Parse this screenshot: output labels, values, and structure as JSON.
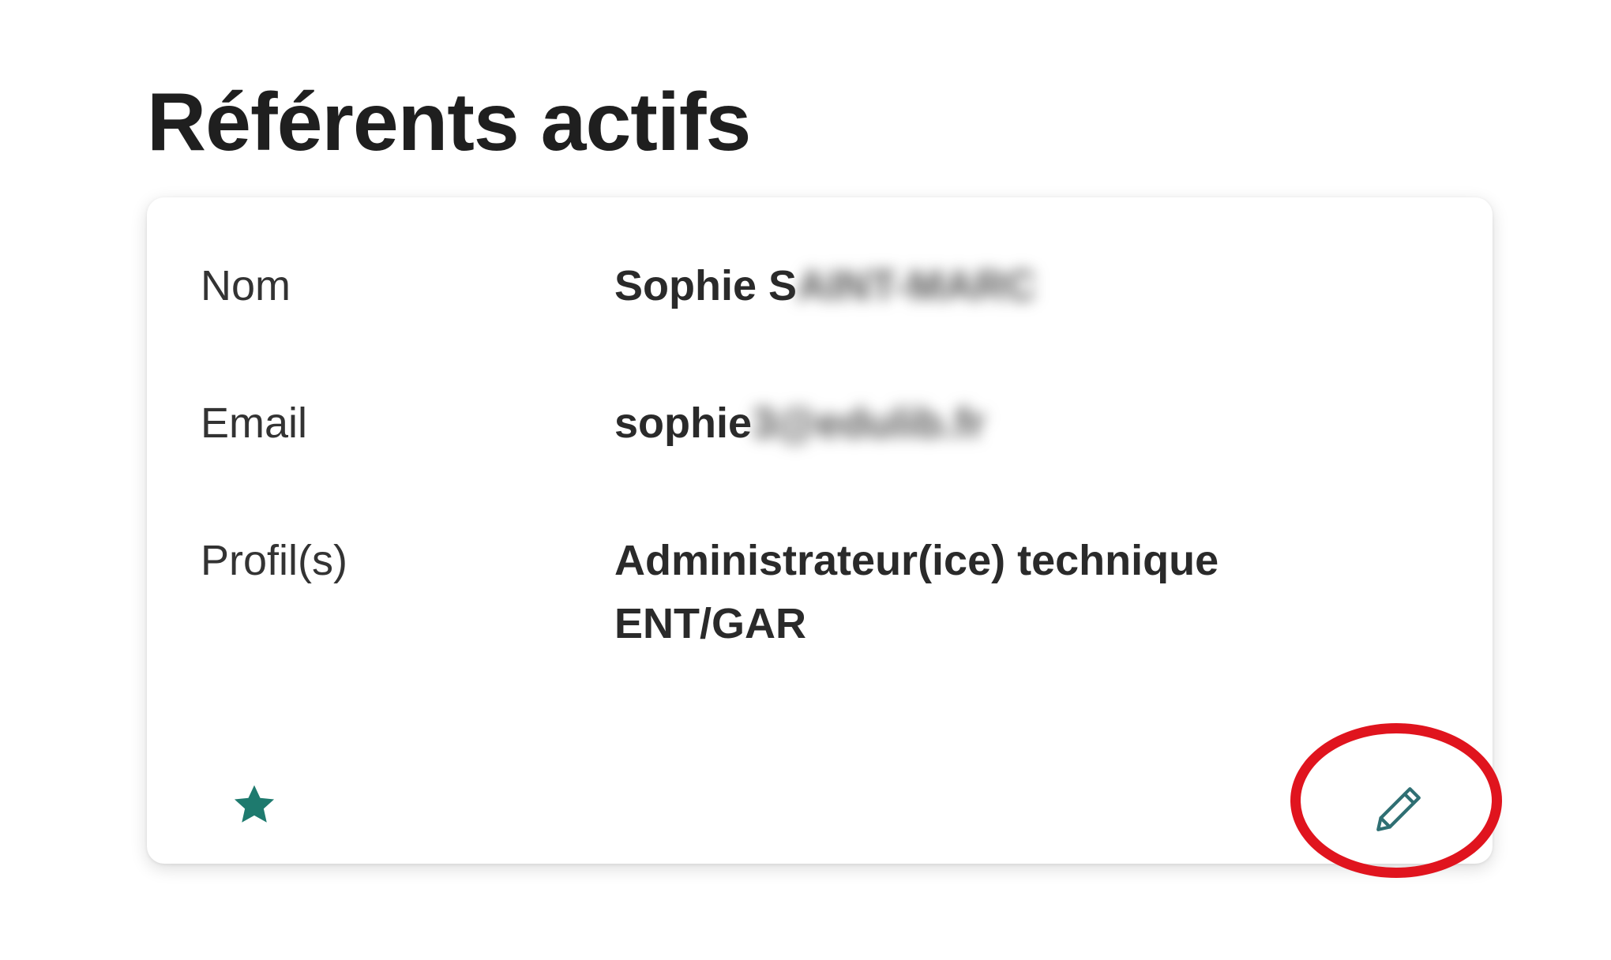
{
  "section": {
    "title": "Référents actifs"
  },
  "referent": {
    "name_label": "Nom",
    "name_value_visible": "Sophie S",
    "name_value_redacted": "AINT-MARC",
    "email_label": "Email",
    "email_value_visible": "sophie",
    "email_value_redacted": "3@edulib.fr",
    "profile_label": "Profil(s)",
    "profile_value_line1": "Administrateur(ice) technique",
    "profile_value_line2": "ENT/GAR"
  },
  "icons": {
    "favorite": "star-icon",
    "edit": "pencil-icon"
  },
  "colors": {
    "star": "#1e7a6e",
    "pencil": "#2f6f73",
    "annotation_ring": "#e0141e",
    "card_background": "#ffffff",
    "title_text": "#1f1f1f"
  }
}
